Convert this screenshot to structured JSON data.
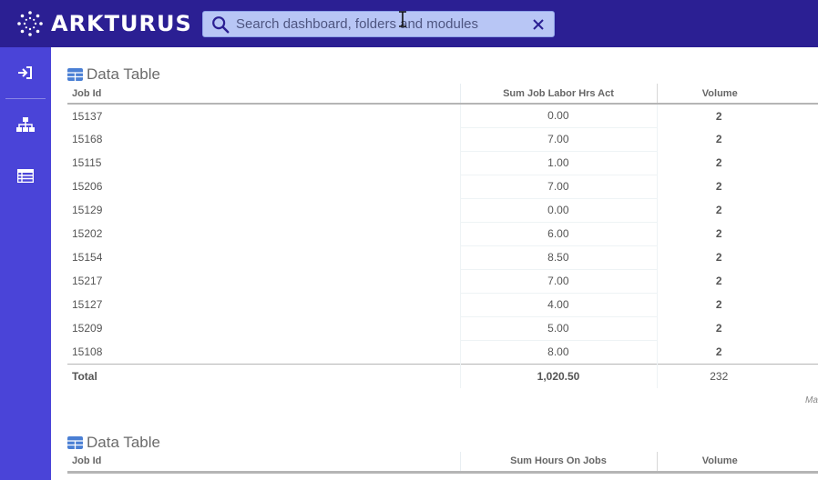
{
  "brand": {
    "name": "ARKTURUS",
    "color": "#2b1f93",
    "sidebar_color": "#4a44d8"
  },
  "search": {
    "placeholder": "Search dashboard, folders and modules"
  },
  "sidebar": {
    "items": [
      {
        "icon": "login-icon"
      },
      {
        "icon": "hierarchy-icon"
      },
      {
        "icon": "table-list-icon"
      }
    ]
  },
  "table1": {
    "title": "Data Table",
    "columns": [
      "Job Id",
      "Sum Job Labor Hrs Act",
      "Volume"
    ],
    "rows": [
      [
        "15137",
        "0.00",
        "2"
      ],
      [
        "15168",
        "7.00",
        "2"
      ],
      [
        "15115",
        "1.00",
        "2"
      ],
      [
        "15206",
        "7.00",
        "2"
      ],
      [
        "15129",
        "0.00",
        "2"
      ],
      [
        "15202",
        "6.00",
        "2"
      ],
      [
        "15154",
        "8.50",
        "2"
      ],
      [
        "15217",
        "7.00",
        "2"
      ],
      [
        "15127",
        "4.00",
        "2"
      ],
      [
        "15209",
        "5.00",
        "2"
      ],
      [
        "15108",
        "8.00",
        "2"
      ]
    ],
    "total": {
      "label": "Total",
      "sum": "1,020.50",
      "volume": "232"
    },
    "more_label": "Ma"
  },
  "table2": {
    "title": "Data Table",
    "columns": [
      "Job Id",
      "Sum Hours On Jobs",
      "Volume"
    ]
  }
}
